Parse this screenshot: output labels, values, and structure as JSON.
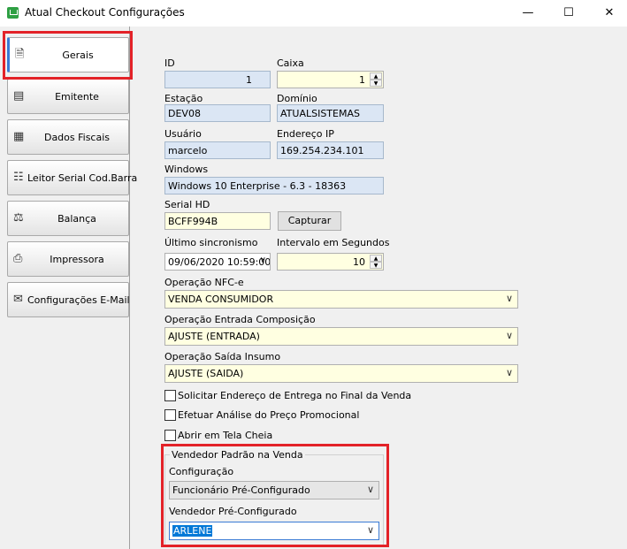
{
  "window": {
    "title": "Atual Checkout Configurações",
    "minimize_icon": "minimize-icon",
    "maximize_icon": "maximize-icon",
    "close_icon": "close-icon"
  },
  "sidebar": {
    "items": [
      {
        "label": "Gerais",
        "icon": "document-icon",
        "active": true
      },
      {
        "label": "Emitente",
        "icon": "card-icon"
      },
      {
        "label": "Dados Fiscais",
        "icon": "cash-register-icon"
      },
      {
        "label": "Leitor Serial Cod.Barra",
        "icon": "barcode-scanner-icon"
      },
      {
        "label": "Balança",
        "icon": "scale-icon"
      },
      {
        "label": "Impressora",
        "icon": "printer-icon"
      },
      {
        "label": "Configurações E-Mail",
        "icon": "email-icon"
      }
    ]
  },
  "form": {
    "id": {
      "label": "ID",
      "value": "1"
    },
    "caixa": {
      "label": "Caixa",
      "value": "1"
    },
    "estacao": {
      "label": "Estação",
      "value": "DEV08"
    },
    "dominio": {
      "label": "Domínio",
      "value": "ATUALSISTEMAS"
    },
    "usuario": {
      "label": "Usuário",
      "value": "marcelo"
    },
    "endereco_ip": {
      "label": "Endereço IP",
      "value": "169.254.234.101"
    },
    "windows": {
      "label": "Windows",
      "value": "Windows 10 Enterprise - 6.3 - 18363"
    },
    "serial_hd": {
      "label": "Serial HD",
      "value": "BCFF994B"
    },
    "capturar_button": "Capturar",
    "ultimo_sincronismo": {
      "label": "Último sincronismo",
      "value": "09/06/2020 10:59:00"
    },
    "intervalo": {
      "label": "Intervalo em Segundos",
      "value": "10"
    },
    "operacao_nfce": {
      "label": "Operação NFC-e",
      "value": "VENDA CONSUMIDOR"
    },
    "operacao_entrada": {
      "label": "Operação Entrada Composição",
      "value": "AJUSTE (ENTRADA)"
    },
    "operacao_saida": {
      "label": "Operação Saída Insumo",
      "value": "AJUSTE (SAIDA)"
    },
    "checkboxes": [
      {
        "label": "Solicitar Endereço de Entrega no Final da Venda",
        "checked": false
      },
      {
        "label": "Efetuar Análise do Preço Promocional",
        "checked": false
      },
      {
        "label": "Abrir em Tela Cheia",
        "checked": false
      }
    ],
    "vendedor_group": {
      "title": "Vendedor Padrão na Venda",
      "configuracao": {
        "label": "Configuração",
        "value": "Funcionário Pré-Configurado"
      },
      "vendedor": {
        "label": "Vendedor Pré-Configurado",
        "value": "ARLENE"
      }
    }
  },
  "colors": {
    "highlight": "#e32228",
    "field_blue": "#dbe6f4",
    "field_yellow": "#ffffe1",
    "selection": "#0078d7"
  }
}
